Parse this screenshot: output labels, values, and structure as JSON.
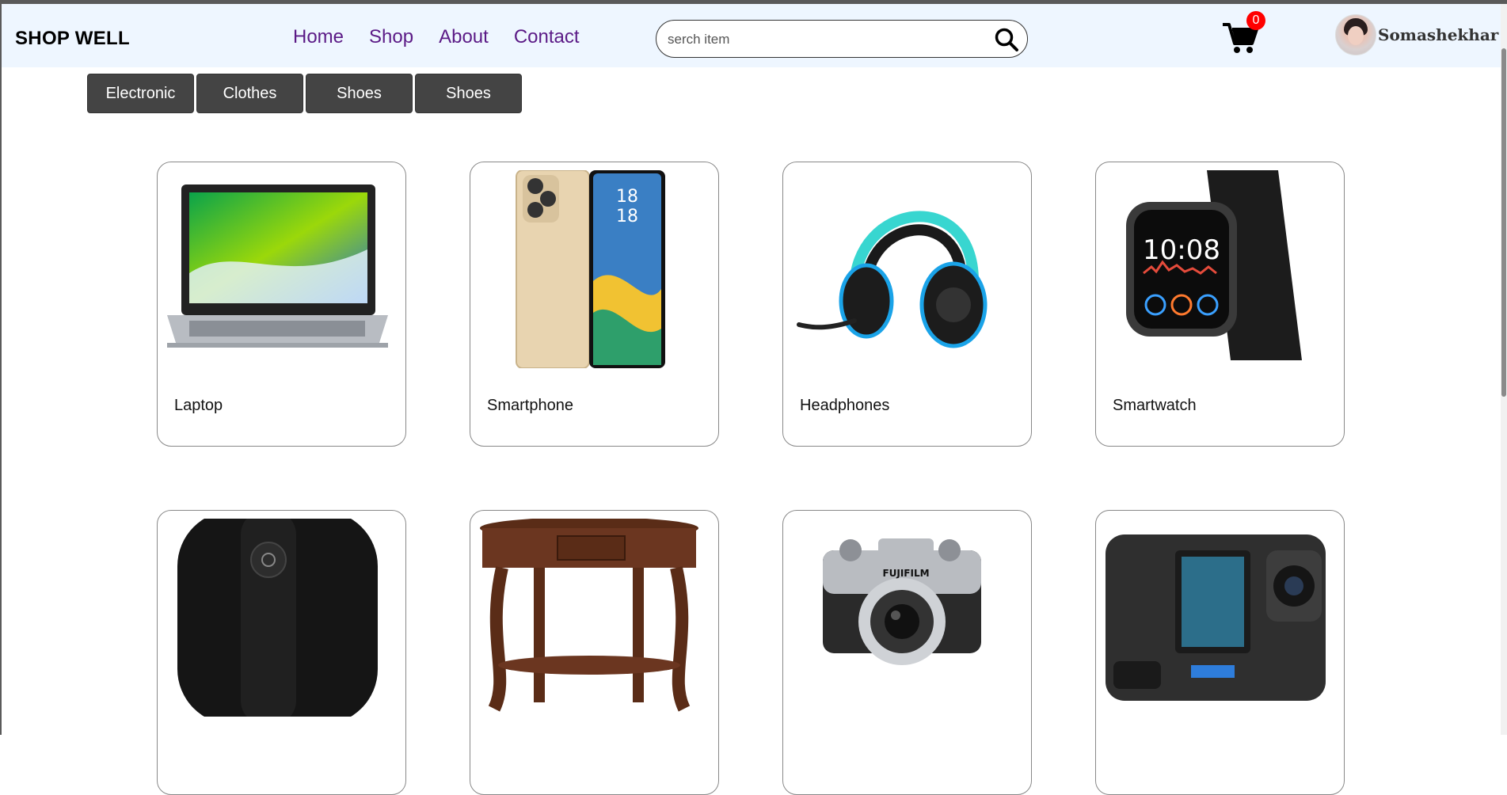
{
  "header": {
    "brand": "SHOP WELL",
    "nav": [
      "Home",
      "Shop",
      "About",
      "Contact"
    ],
    "search": {
      "placeholder": "serch item",
      "value": ""
    },
    "cart_count": "0",
    "username": "Somashekhar"
  },
  "categories": [
    "Electronic",
    "Clothes",
    "Shoes",
    "Shoes"
  ],
  "products": [
    {
      "name": "Laptop",
      "icon": "laptop"
    },
    {
      "name": "Smartphone",
      "icon": "smartphone"
    },
    {
      "name": "Headphones",
      "icon": "headphones"
    },
    {
      "name": "Smartwatch",
      "icon": "smartwatch"
    },
    {
      "name": "",
      "icon": "speaker"
    },
    {
      "name": "",
      "icon": "table"
    },
    {
      "name": "",
      "icon": "camera"
    },
    {
      "name": "",
      "icon": "action-camera"
    }
  ],
  "colors": {
    "header_bg": "#eef6ff",
    "nav_link": "#5b1a86",
    "category_bg": "#444444",
    "badge": "#ff0000"
  }
}
